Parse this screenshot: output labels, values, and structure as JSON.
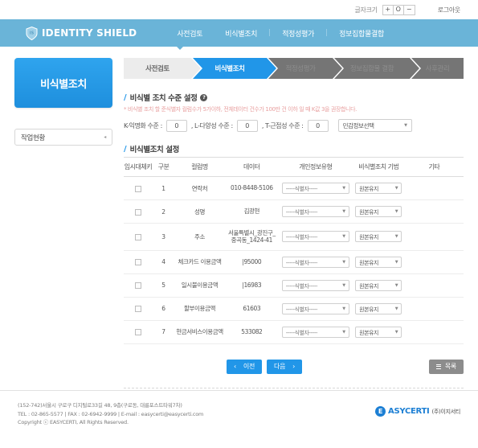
{
  "topbar": {
    "fontsize_label": "글자크기",
    "increase": "+",
    "reset": "O",
    "decrease": "−",
    "logout": "로그아웃"
  },
  "header": {
    "brand": "IDENTITY SHIELD",
    "nav": [
      {
        "label": "사전검토"
      },
      {
        "label": "비식별조치"
      },
      {
        "label": "적정성평가"
      },
      {
        "label": "정보집합물결합"
      }
    ],
    "separator": "|",
    "bg_color": "#6ab4d8"
  },
  "sidebar": {
    "title": "비식별조치",
    "menu": {
      "label": "작업현황",
      "caret": "◂"
    },
    "title_color": "#2196e8"
  },
  "steps": [
    {
      "label": "사전검토",
      "state": "done"
    },
    {
      "label": "비식별조치",
      "state": "active"
    },
    {
      "label": "적정성평가",
      "state": "pending"
    },
    {
      "label": "정보집합물 결합",
      "state": "pending"
    },
    {
      "label": "사후관리",
      "state": "pending"
    }
  ],
  "level_section": {
    "title": "비식별 조치 수준 설정",
    "help": "?",
    "description": "* 비식별 조치 할 준식별자 컬럼수가 5가이하, 전체데이터 건수가 100만 건 이하 일 때 K값 3을 권장합니다.",
    "prefix": "*",
    "k_label": "K-익명화 수준 :",
    "k_value": "0",
    "comma1": ",",
    "l_label": "L-다양성 수준 :",
    "l_value": "0",
    "comma2": ",",
    "t_label": "T-근접성 수준 :",
    "t_value": "0",
    "sensitive_select": "민감정보선택",
    "caret": "▼"
  },
  "table_section": {
    "title": "비식별조치 설정",
    "columns": [
      "임시대체키",
      "구분",
      "컬럼명",
      "데이터",
      "개인정보유형",
      "비식별조치 기법",
      "기타"
    ],
    "rows": [
      {
        "no": "1",
        "column": "연락처",
        "data": "010-8448-5106",
        "type": "-----식별자-----",
        "tech": "원본유지",
        "etc": ""
      },
      {
        "no": "2",
        "column": "성명",
        "data": "김광현",
        "type": "-----식별자-----",
        "tech": "원본유지",
        "etc": ""
      },
      {
        "no": "3",
        "column": "주소",
        "data": "서울특별시_광진구_중곡동_1424-41",
        "type": "-----식별자-----",
        "tech": "원본유지",
        "etc": ""
      },
      {
        "no": "4",
        "column": "체크카드 이용금액",
        "data": "|95000",
        "type": "-----식별자-----",
        "tech": "원본유지",
        "etc": ""
      },
      {
        "no": "5",
        "column": "일시불이용금액",
        "data": "|16983",
        "type": "-----식별자-----",
        "tech": "원본유지",
        "etc": ""
      },
      {
        "no": "6",
        "column": "할부이용금액",
        "data": "61603",
        "type": "-----식별자-----",
        "tech": "원본유지",
        "etc": ""
      },
      {
        "no": "7",
        "column": "현금서비스이용금액",
        "data": "533082",
        "type": "-----식별자-----",
        "tech": "원본유지",
        "etc": ""
      }
    ]
  },
  "actions": {
    "prev_arrow": "‹",
    "prev": "이전",
    "next": "다음",
    "next_arrow": "›",
    "list": "목록"
  },
  "footer": {
    "line1": "(152-742)서울시 구로구 디지털로33길 48, 9층(구로동, 대륭포스트타워7차)",
    "line2": "TEL : 02-865-5577 | FAX : 02-6942-9999 | E-mail : easycerti@easycerti.com",
    "line3": "Copyright ⓒ EASYCERTI, All Rights Reserved.",
    "logo_mark": "E",
    "logo_text": "ASYCERTI",
    "logo_sub": "(주)이지서티"
  }
}
